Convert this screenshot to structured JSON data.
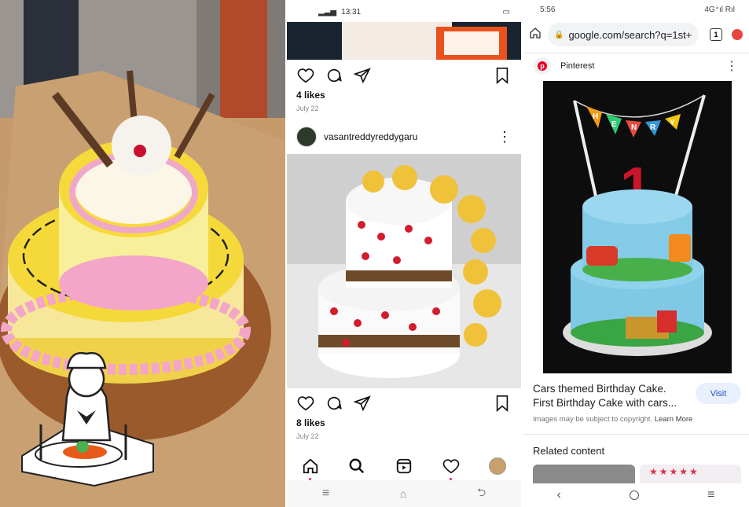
{
  "instagram": {
    "status_time": "13:31",
    "post1": {
      "likes": "4 likes",
      "date": "July 22"
    },
    "post2": {
      "username": "vasantreddyreddygaru",
      "likes": "8 likes",
      "date": "July 22"
    }
  },
  "google": {
    "status_time": "5:56",
    "status_right": "4G⁺ıl  Rıl",
    "tab_count": "1",
    "url": "google.com/search?q=1st+",
    "source": "Pinterest",
    "result_title": "Cars themed Birthday Cake. First Birthday Cake with cars...",
    "visit_label": "Visit",
    "copyright": "Images may be subject to copyright.",
    "learn_more": "Learn More",
    "related": "Related content"
  },
  "cake_banner": {
    "letters": [
      "H",
      "E",
      "N",
      "R",
      "Y"
    ],
    "number": "1"
  },
  "icons": [
    "heart-icon",
    "comment-icon",
    "share-icon",
    "bookmark-icon",
    "more-icon",
    "home-icon",
    "search-icon",
    "reels-icon",
    "activity-icon",
    "lock-icon",
    "menu-icon",
    "back-icon",
    "chef-icon"
  ]
}
